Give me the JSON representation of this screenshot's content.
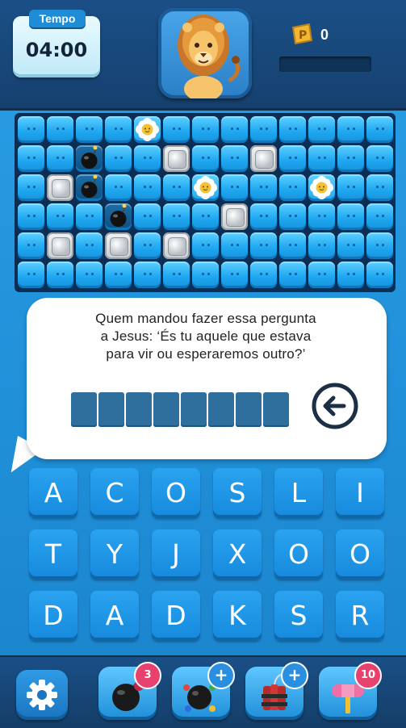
{
  "header": {
    "timer_label": "Tempo",
    "timer_value": "04:00",
    "avatar_icon": "lion-mascot-icon",
    "coin_icon": "gold-ticket-icon",
    "coin_count": "0",
    "progress": 0
  },
  "board": {
    "rows": [
      [
        "cube",
        "cube",
        "cube",
        "cube",
        "flower",
        "cube",
        "cube",
        "cube",
        "cube",
        "cube",
        "cube",
        "cube",
        "cube"
      ],
      [
        "cube",
        "cube",
        "bomb",
        "cube",
        "cube",
        "ice",
        "cube",
        "cube",
        "ice",
        "cube",
        "cube",
        "cube",
        "cube"
      ],
      [
        "cube",
        "ice",
        "bomb",
        "cube",
        "cube",
        "cube",
        "flower",
        "cube",
        "cube",
        "cube",
        "flower",
        "cube",
        "cube"
      ],
      [
        "cube",
        "cube",
        "cube",
        "bomb",
        "cube",
        "cube",
        "cube",
        "ice",
        "cube",
        "cube",
        "cube",
        "cube",
        "cube"
      ],
      [
        "cube",
        "ice",
        "cube",
        "ice",
        "cube",
        "ice",
        "cube",
        "cube",
        "cube",
        "cube",
        "cube",
        "cube",
        "cube"
      ],
      [
        "cube",
        "cube",
        "cube",
        "cube",
        "cube",
        "cube",
        "cube",
        "cube",
        "cube",
        "cube",
        "cube",
        "cube",
        "cube"
      ]
    ]
  },
  "question": {
    "line1": "Quem mandou fazer essa pergunta",
    "line2": "a  Jesus: ‘És tu aquele que estava",
    "line3": "para vir ou esperaremos outro?’",
    "answer_slots": 8,
    "backspace_icon": "backspace-arrow-icon"
  },
  "keyboard": {
    "keys": [
      "A",
      "C",
      "O",
      "S",
      "L",
      "I",
      "T",
      "Y",
      "J",
      "X",
      "O",
      "O",
      "D",
      "A",
      "D",
      "K",
      "S",
      "R"
    ]
  },
  "toolbar": {
    "settings_icon": "gear-icon",
    "items": [
      {
        "name": "bomb-powerup",
        "icon": "bomb-icon",
        "badge": "3"
      },
      {
        "name": "multi-bomb-powerup",
        "icon": "spiked-bomb-icon",
        "badge": "+"
      },
      {
        "name": "dynamite-powerup",
        "icon": "dynamite-icon",
        "badge": "+"
      },
      {
        "name": "hammer-powerup",
        "icon": "hammer-icon",
        "badge": "10"
      }
    ]
  },
  "colors": {
    "background": "#1f8fd8",
    "header": "#1a4f86",
    "key": "#1689dc",
    "slot": "#2e6f9e",
    "badge": "#e8416e"
  }
}
